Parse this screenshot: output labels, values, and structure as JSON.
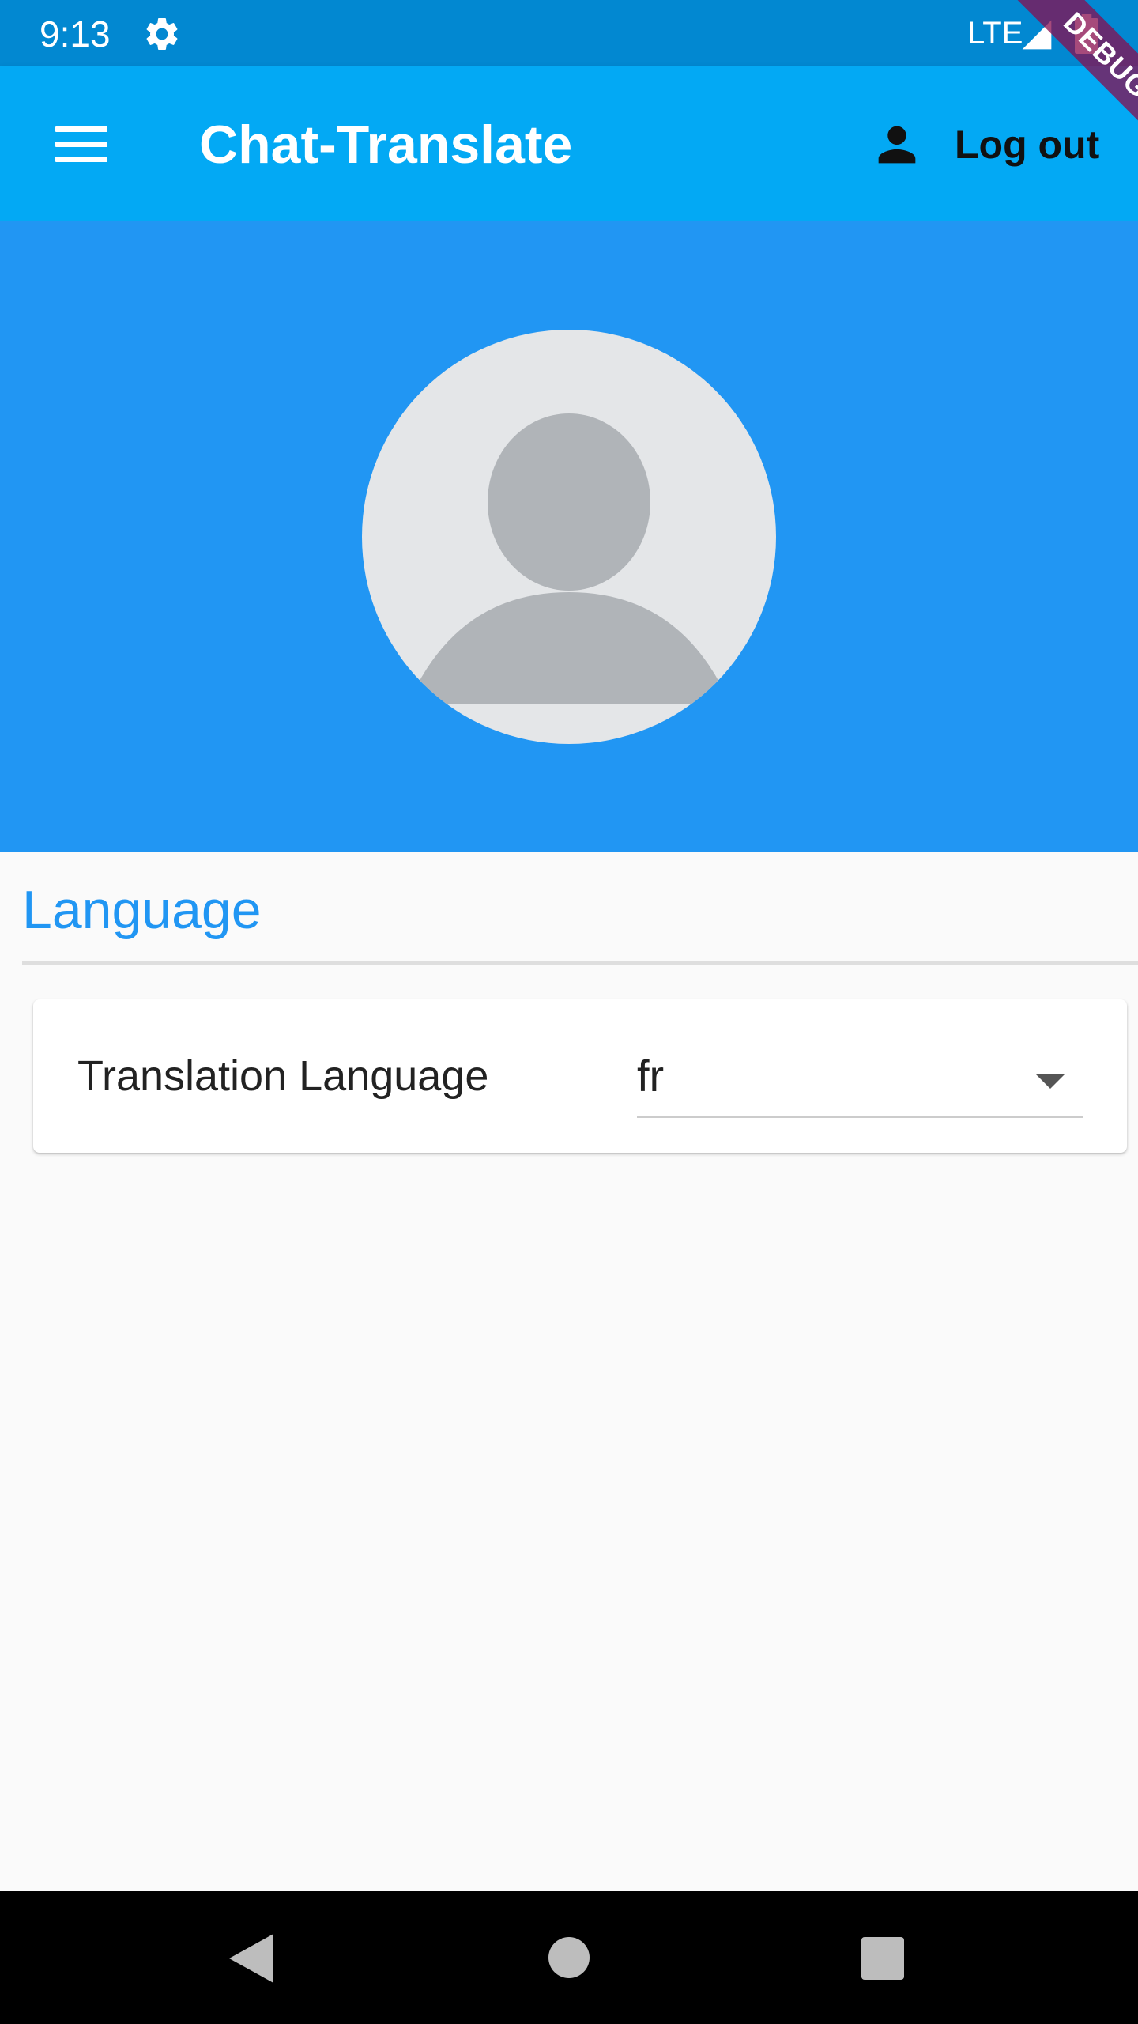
{
  "status_bar": {
    "time": "9:13",
    "network": "LTE",
    "icons": [
      "gear-icon",
      "signal-icon",
      "battery-icon"
    ]
  },
  "debug_banner": "DEBUG",
  "app_bar": {
    "title": "Chat-Translate",
    "menu_icon": "menu-icon",
    "logout_icon": "person-icon",
    "logout_label": "Log out",
    "color": "#03a9f4"
  },
  "profile": {
    "avatar_icon": "default-avatar-icon",
    "header_color": "#2196f3"
  },
  "language_section": {
    "title": "Language",
    "setting_label": "Translation Language",
    "selected_value": "fr"
  },
  "nav_bar": {
    "buttons": [
      "back-icon",
      "home-icon",
      "recents-icon"
    ]
  }
}
